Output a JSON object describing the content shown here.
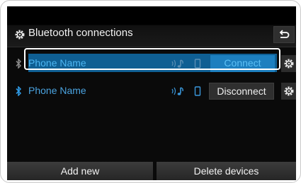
{
  "header": {
    "title": "Bluetooth connections",
    "title_icon": "gear-icon",
    "back_icon": "back-arrow-icon"
  },
  "devices": [
    {
      "name": "Phone Name",
      "action_label": "Connect",
      "selected": true,
      "connected": false,
      "icons": [
        "bluetooth-icon",
        "audio-streaming-icon",
        "phone-icon",
        "gear-icon"
      ]
    },
    {
      "name": "Phone Name",
      "action_label": "Disconnect",
      "selected": false,
      "connected": true,
      "icons": [
        "bluetooth-icon",
        "audio-streaming-icon",
        "phone-icon",
        "gear-icon"
      ]
    }
  ],
  "footer": {
    "add_label": "Add new",
    "delete_label": "Delete devices"
  },
  "colors": {
    "selected_row": "#0f5f93",
    "selected_text": "#4cb6f2",
    "connected_accent": "#4aa3e0",
    "screen_bg": "#0a0a0a",
    "button_bg": "#2f2f2f"
  }
}
